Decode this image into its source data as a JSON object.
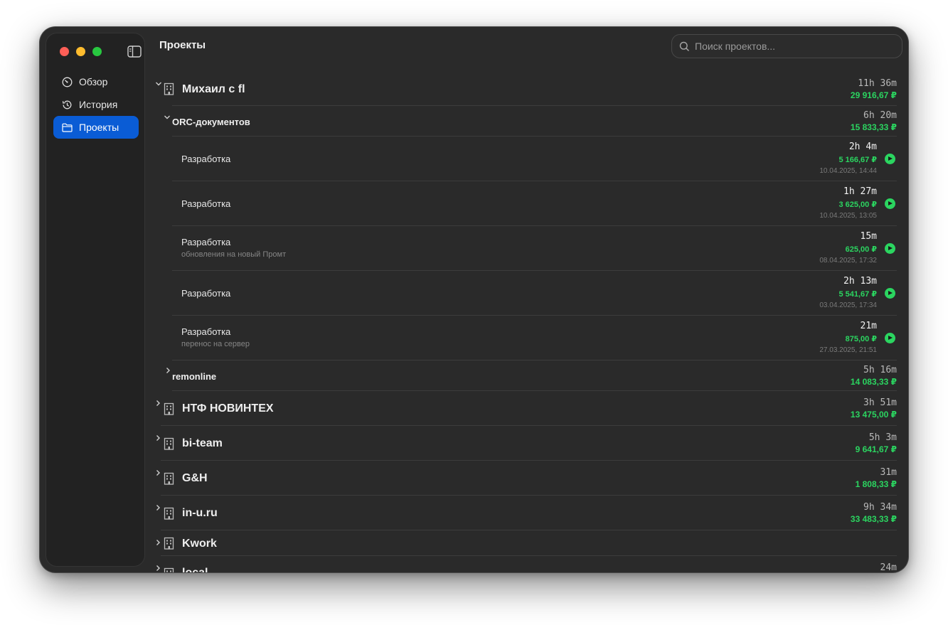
{
  "app": {
    "title": "Проекты"
  },
  "search": {
    "placeholder": "Поиск проектов..."
  },
  "sidebar": {
    "items": [
      {
        "label": "Обзор",
        "icon": "gauge-icon"
      },
      {
        "label": "История",
        "icon": "history-icon"
      },
      {
        "label": "Проекты",
        "icon": "folder-icon",
        "active": true
      }
    ]
  },
  "colors": {
    "accent": "#0a5cd5",
    "money": "#2bd560",
    "background": "#2a2a2a"
  },
  "clients": [
    {
      "name": "Михаил с fl",
      "duration": "11h 36m",
      "amount": "29 916,67 ₽",
      "expanded": true,
      "projects": [
        {
          "name": "ORC-документов",
          "duration": "6h 20m",
          "amount": "15 833,33 ₽",
          "expanded": true,
          "entries": [
            {
              "name": "Разработка",
              "note": "",
              "duration": "2h 4m",
              "amount": "5 166,67 ₽",
              "date": "10.04.2025, 14:44"
            },
            {
              "name": "Разработка",
              "note": "",
              "duration": "1h 27m",
              "amount": "3 625,00 ₽",
              "date": "10.04.2025, 13:05"
            },
            {
              "name": "Разработка",
              "note": "обновления на новый Промт",
              "duration": "15m",
              "amount": "625,00 ₽",
              "date": "08.04.2025, 17:32"
            },
            {
              "name": "Разработка",
              "note": "",
              "duration": "2h 13m",
              "amount": "5 541,67 ₽",
              "date": "03.04.2025, 17:34"
            },
            {
              "name": "Разработка",
              "note": "перенос на сервер",
              "duration": "21m",
              "amount": "875,00 ₽",
              "date": "27.03.2025, 21:51"
            }
          ]
        },
        {
          "name": "remonline",
          "duration": "5h 16m",
          "amount": "14 083,33 ₽",
          "expanded": false
        }
      ]
    },
    {
      "name": "НТФ НОВИНТЕХ",
      "duration": "3h 51m",
      "amount": "13 475,00 ₽"
    },
    {
      "name": "bi-team",
      "duration": "5h 3m",
      "amount": "9 641,67 ₽"
    },
    {
      "name": "G&H",
      "duration": "31m",
      "amount": "1 808,33 ₽"
    },
    {
      "name": "in-u.ru",
      "duration": "9h 34m",
      "amount": "33 483,33 ₽"
    },
    {
      "name": "Kwork",
      "duration": "",
      "amount": ""
    },
    {
      "name": "local",
      "duration": "24m",
      "amount": ""
    }
  ]
}
